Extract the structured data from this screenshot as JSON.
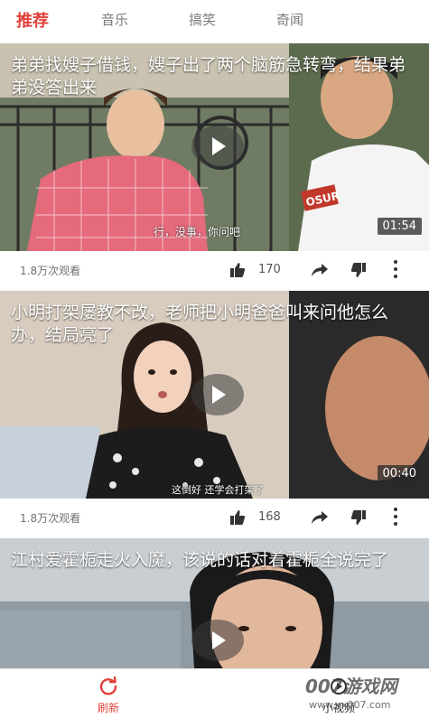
{
  "tabs": [
    {
      "label": "推荐",
      "active": true
    },
    {
      "label": "音乐",
      "active": false
    },
    {
      "label": "搞笑",
      "active": false
    },
    {
      "label": "奇闻",
      "active": false
    }
  ],
  "accent_color": "#e0403a",
  "videos": [
    {
      "title": "弟弟找嫂子借钱，嫂子出了两个脑筋急转弯，结果弟弟没答出来",
      "duration": "01:54",
      "subtitle": "行，没事，你问吧",
      "shirt_text": "OSUR",
      "views": "1.8万次观看",
      "likes": "170"
    },
    {
      "title": "小明打架屡教不改，老师把小明爸爸叫来问他怎么办，结局亮了",
      "duration": "00:40",
      "subtitle": "这倒好 还学会打架了",
      "views": "1.8万次观看",
      "likes": "168"
    },
    {
      "title": "江村爱霍栀走火入魔，该说的话对着霍栀全说完了"
    }
  ],
  "bottom_nav": {
    "refresh_label": "刷新",
    "short_video_label": "小视频"
  },
  "watermark": {
    "brand": "007游戏网",
    "url": "www.yx007.com"
  }
}
